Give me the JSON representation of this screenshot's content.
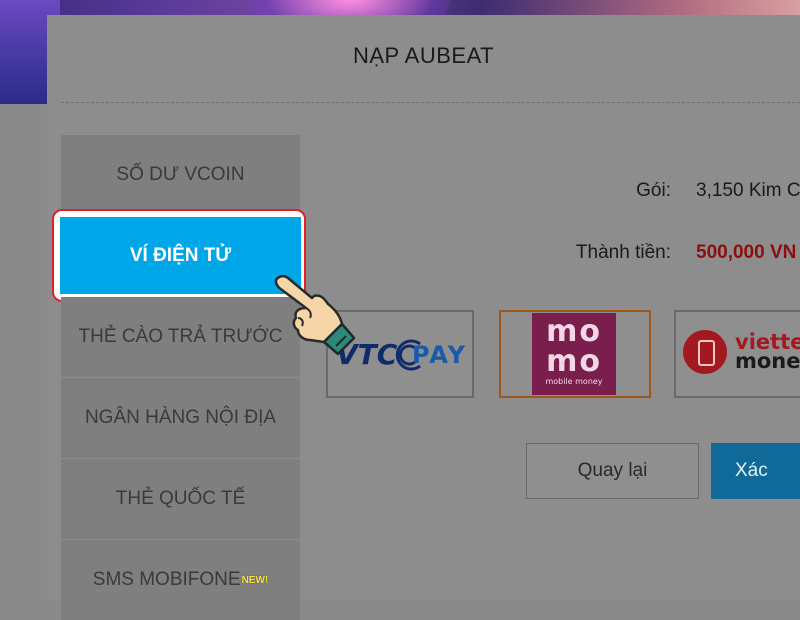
{
  "modal": {
    "title": "NẠP AUBEAT"
  },
  "tabs": [
    {
      "label": "SỐ DƯ VCOIN",
      "active": false
    },
    {
      "label": "VÍ ĐIỆN TỬ",
      "active": true
    },
    {
      "label": "THẺ CÀO TRẢ TRƯỚC",
      "active": false
    },
    {
      "label": "NGÂN HÀNG NỘI ĐỊA",
      "active": false
    },
    {
      "label": "THẺ QUỐC TẾ",
      "active": false
    },
    {
      "label": "SMS MOBIFONE",
      "badge": "NEW!",
      "active": false
    }
  ],
  "summary": {
    "package_label": "Gói:",
    "package_value": "3,150 Kim C",
    "total_label": "Thành tiền:",
    "total_value": "500,000 VN"
  },
  "wallets": {
    "vtcpay": {
      "text_vtc": "VTC",
      "text_pay": "PAY"
    },
    "momo": {
      "line1": "mo",
      "line2": "mo",
      "sub": "mobile money",
      "selected": true
    },
    "viettel": {
      "line1": "viette",
      "line2": "mone"
    }
  },
  "buttons": {
    "back_label": "Quay lại",
    "confirm_label": "Xác"
  },
  "colors": {
    "active_tab": "#00a7e8",
    "highlight_ring": "#e0202a",
    "total_value": "#8b0f10",
    "momo_brand": "#7a1e4e",
    "viettel_brand": "#a4181f",
    "confirm_button": "#0f6a9a"
  },
  "icons": [
    "pointing-hand-icon",
    "vtcpay-logo",
    "momo-logo",
    "viettel-money-logo"
  ]
}
